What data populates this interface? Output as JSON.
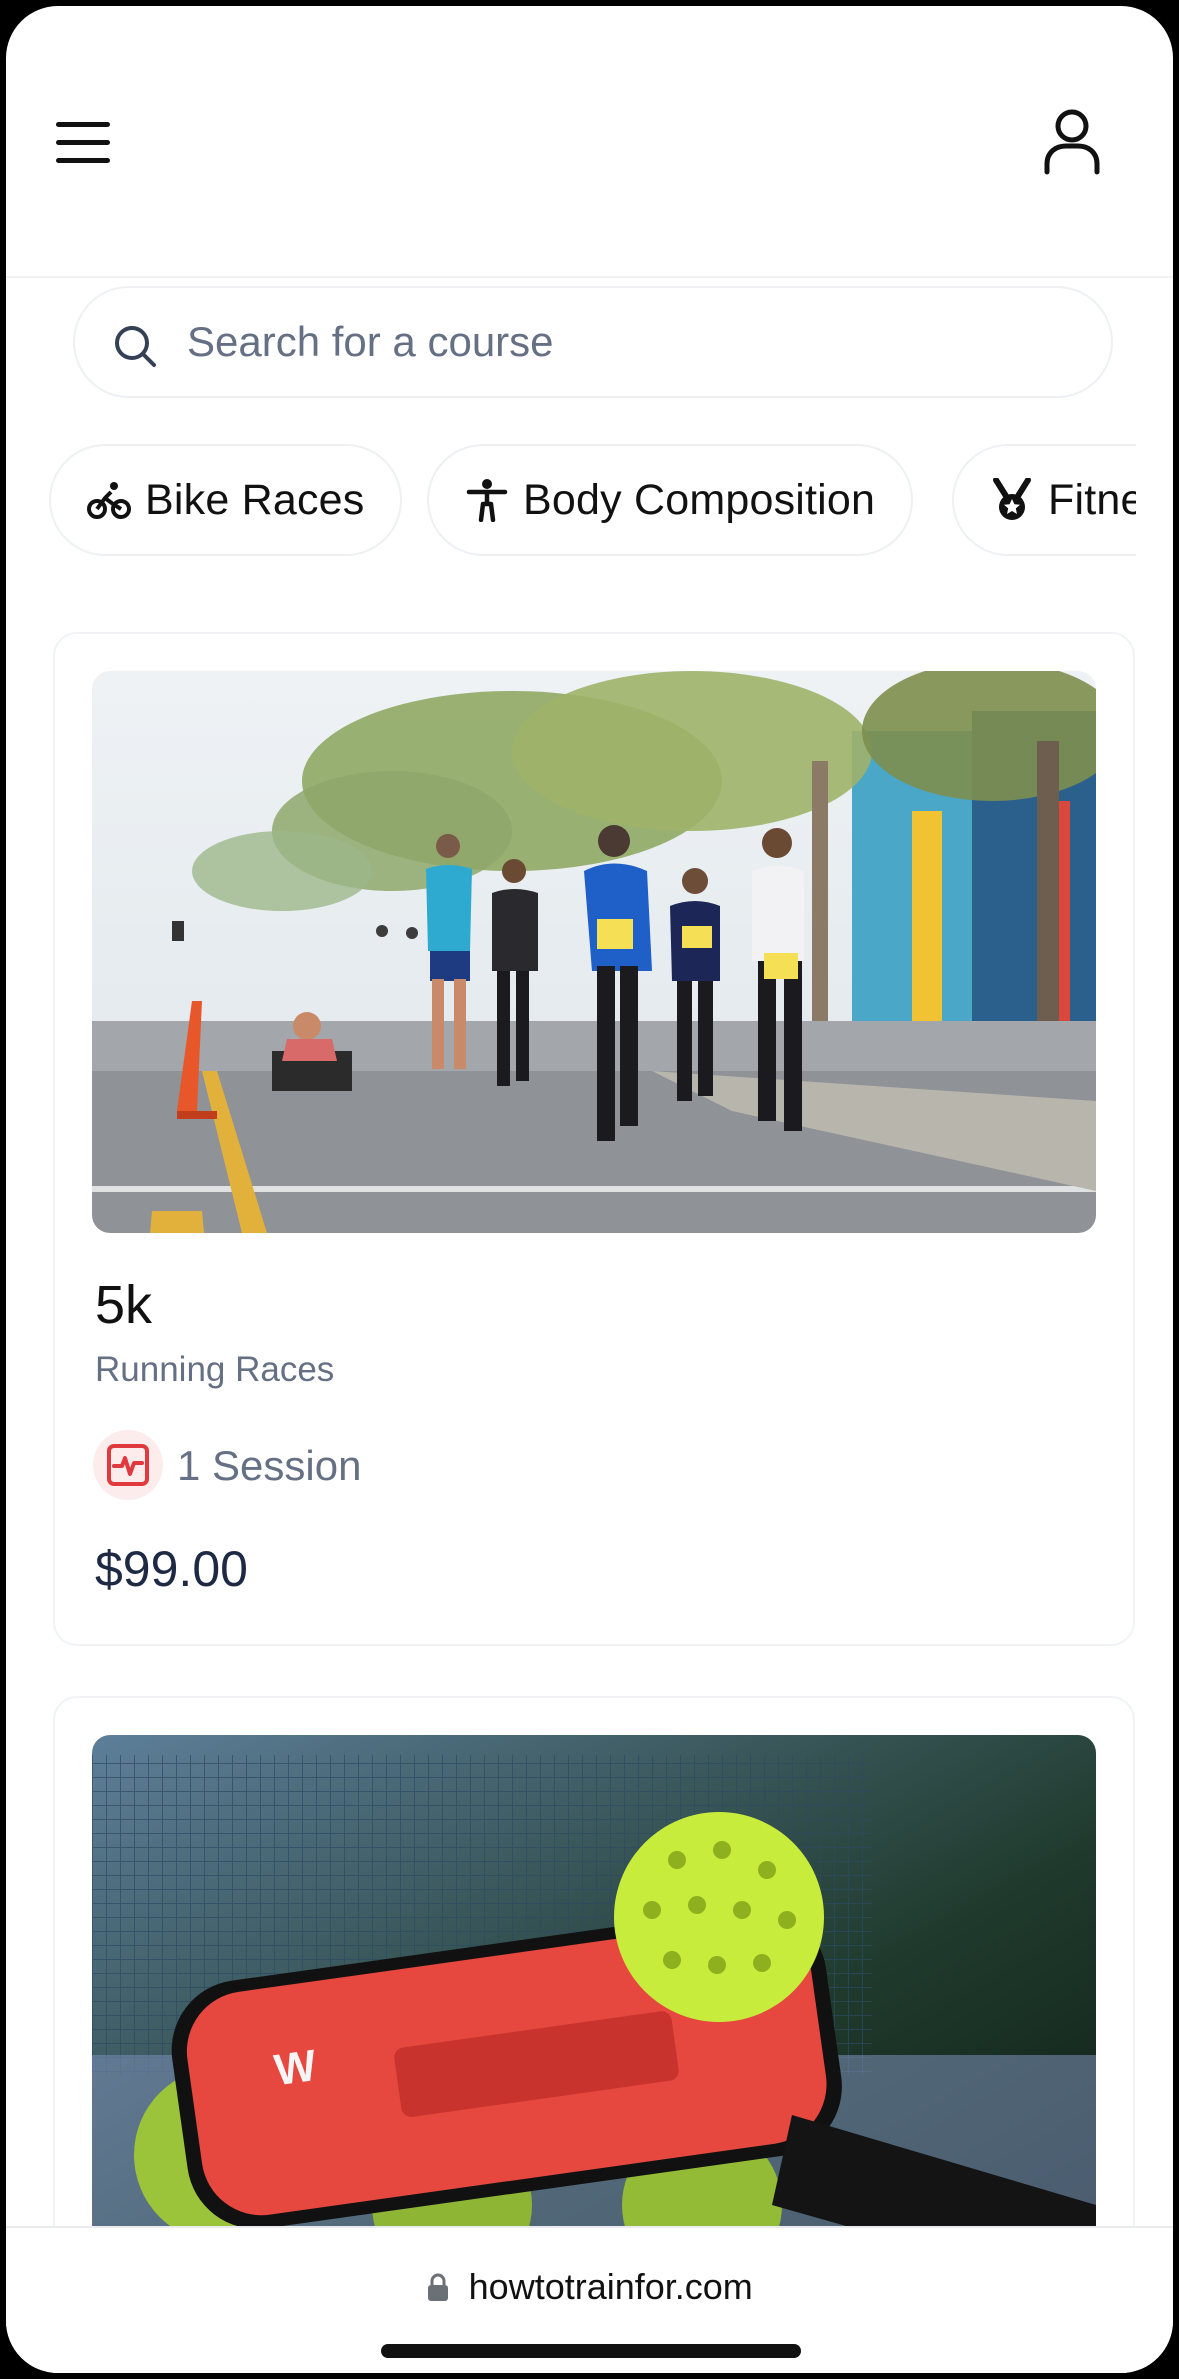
{
  "header": {
    "menu_icon": "hamburger-menu-icon",
    "profile_icon": "user-icon"
  },
  "search": {
    "placeholder": "Search for a course",
    "icon": "search-icon"
  },
  "categories": [
    {
      "label": "Bike Races",
      "icon": "bike-icon"
    },
    {
      "label": "Body Composition",
      "icon": "person-icon"
    },
    {
      "label": "Fitness",
      "icon": "medal-icon"
    }
  ],
  "courses": [
    {
      "title": "5k",
      "category": "Running Races",
      "sessions": "1 Session",
      "price": "$99.00",
      "session_icon": "activity-icon",
      "image": "runners-on-street-photo"
    },
    {
      "image": "pickleball-paddle-photo"
    }
  ],
  "browser": {
    "url": "howtotrainfor.com",
    "lock_icon": "lock-icon"
  },
  "colors": {
    "accent_red": "#e0393e",
    "muted_text": "#667085",
    "price_text": "#1e2a44"
  }
}
